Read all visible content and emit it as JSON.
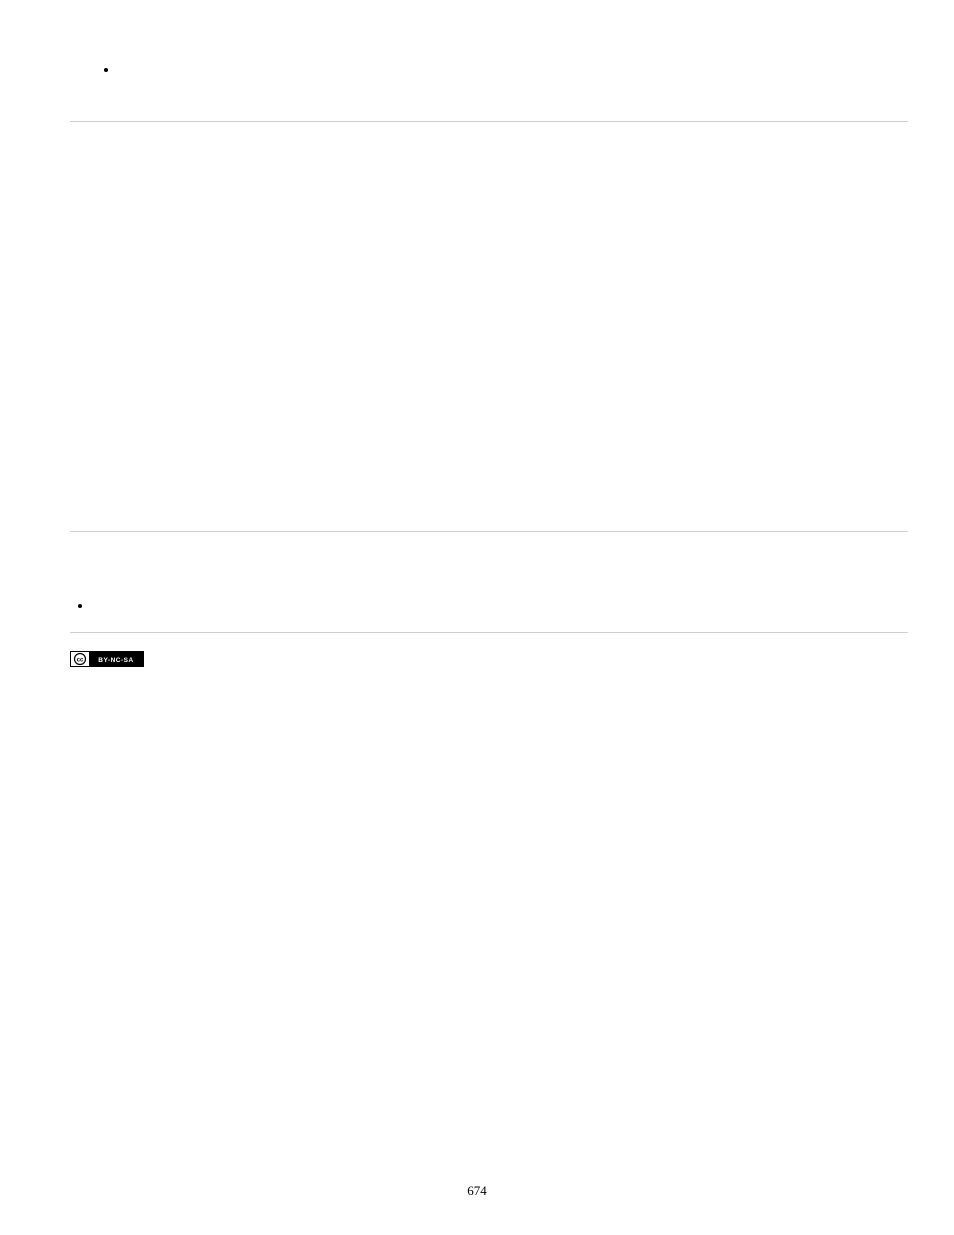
{
  "page": {
    "number": "674"
  },
  "cc_badge": {
    "label": "BY-NC-SA",
    "cc_text": "cc"
  }
}
